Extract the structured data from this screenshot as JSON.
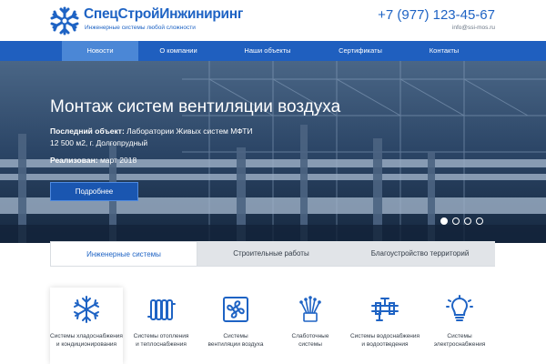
{
  "header": {
    "brand": "СпецСтройИнжиниринг",
    "tagline": "Инженерные системы любой сложности",
    "phone": "+7 (977) 123-45-67",
    "email": "info@ssi-mos.ru"
  },
  "nav": {
    "items": [
      {
        "label": "Новости"
      },
      {
        "label": "О компании"
      },
      {
        "label": "Наши объекты"
      },
      {
        "label": "Сертификаты"
      },
      {
        "label": "Контакты"
      }
    ],
    "active_index": 0
  },
  "hero": {
    "title": "Монтаж систем вентиляции воздуха",
    "last_object_label": "Последний объект:",
    "last_object_value": "Лаборатории Живых систем МФТИ",
    "address": "12 500 м2, г. Долгопрудный",
    "realized_label": "Реализован:",
    "realized_value": "март 2018",
    "button_label": "Подробнее",
    "slides_total": 4,
    "slide_active": 1
  },
  "tabs": {
    "items": [
      {
        "label": "Инженерные системы"
      },
      {
        "label": "Строительные работы"
      },
      {
        "label": "Благоустройство территорий"
      }
    ],
    "active_index": 0
  },
  "services": [
    {
      "icon": "snowflake-icon",
      "line1": "Системы хладоснабжения",
      "line2": "и кондиционирования"
    },
    {
      "icon": "radiator-icon",
      "line1": "Системы отопления",
      "line2": "и теплоснабжения"
    },
    {
      "icon": "fan-icon",
      "line1": "Системы",
      "line2": "вентиляции воздуха"
    },
    {
      "icon": "network-icon",
      "line1": "Слаботочные",
      "line2": "системы"
    },
    {
      "icon": "pipes-icon",
      "line1": "Системы водоснабжения",
      "line2": "и водоотведения"
    },
    {
      "icon": "lightbulb-icon",
      "line1": "Системы",
      "line2": "электроснабжения"
    }
  ],
  "colors": {
    "brand": "#1e63c4",
    "nav_bg": "#1f5fbf",
    "nav_active": "#4b87d6"
  }
}
